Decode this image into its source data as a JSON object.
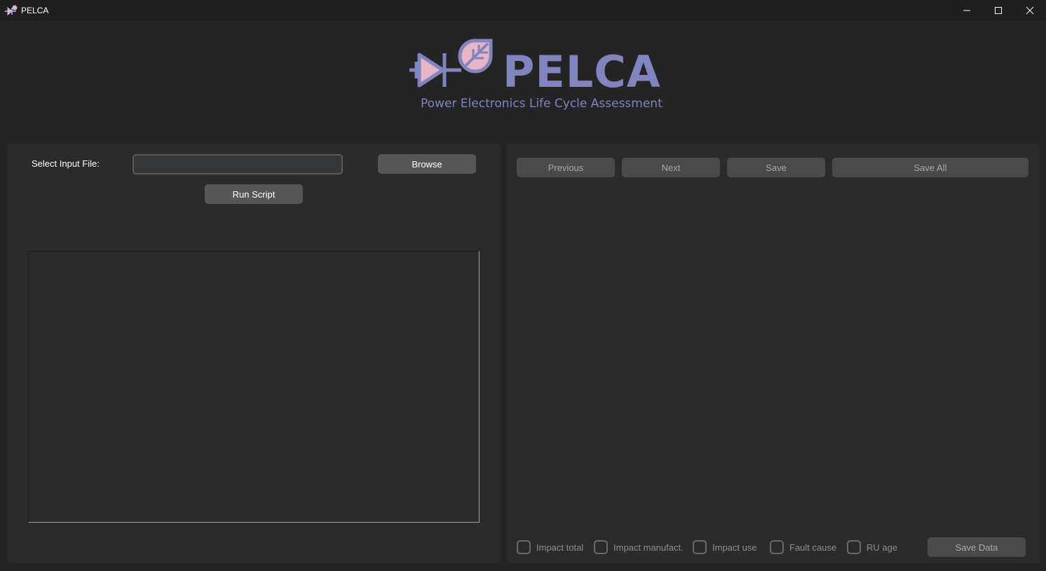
{
  "window": {
    "title": "PELCA"
  },
  "logo": {
    "wordmark": "PELCA",
    "subtitle": "Power Electronics Life Cycle Assessment"
  },
  "input_panel": {
    "select_label": "Select Input File:",
    "file_value": "",
    "browse_label": "Browse",
    "run_label": "Run Script",
    "output_text": ""
  },
  "results_panel": {
    "previous_label": "Previous",
    "next_label": "Next",
    "save_label": "Save",
    "save_all_label": "Save All",
    "checkboxes": [
      {
        "label": "Impact total",
        "checked": false
      },
      {
        "label": "Impact manufact.",
        "checked": false
      },
      {
        "label": "Impact use",
        "checked": false
      },
      {
        "label": "Fault cause",
        "checked": false
      },
      {
        "label": "RU age",
        "checked": false
      }
    ],
    "save_data_label": "Save Data"
  },
  "colors": {
    "brand": "#8185bf",
    "brand_accent": "#e8b4c8",
    "background": "#242424",
    "panel": "#2b2b2b",
    "button": "#565656"
  },
  "icons": {
    "app": "pelca-logo-icon",
    "minimize": "minimize-icon",
    "maximize": "maximize-icon",
    "close": "close-icon"
  }
}
